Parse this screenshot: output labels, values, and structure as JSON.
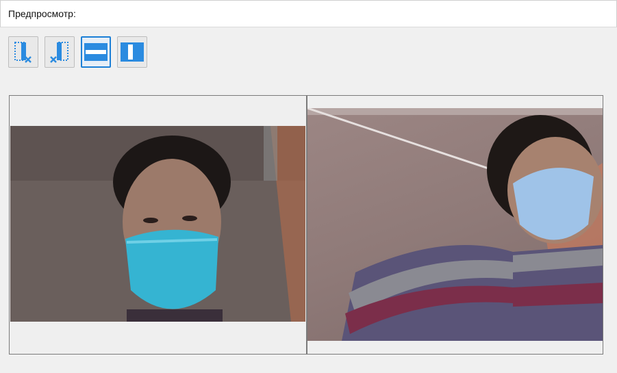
{
  "window": {
    "title": "Предпросмотр:"
  },
  "toolbar": {
    "buttons": [
      {
        "name": "remove-left-frame",
        "icon": "frame-remove-right-icon",
        "active": false
      },
      {
        "name": "remove-right-frame",
        "icon": "frame-remove-left-icon",
        "active": false
      },
      {
        "name": "horizontal-layout",
        "icon": "layout-horizontal-icon",
        "active": true
      },
      {
        "name": "vertical-layout",
        "icon": "layout-vertical-icon",
        "active": false
      }
    ]
  },
  "preview": {
    "frames": [
      {
        "name": "left-camera-frame",
        "content": "camera-photo"
      },
      {
        "name": "right-camera-frame",
        "content": "camera-photo"
      }
    ]
  },
  "colors": {
    "accent": "#1c7fd6",
    "icon_blue": "#2b8be0",
    "background": "#f0f0f0"
  }
}
